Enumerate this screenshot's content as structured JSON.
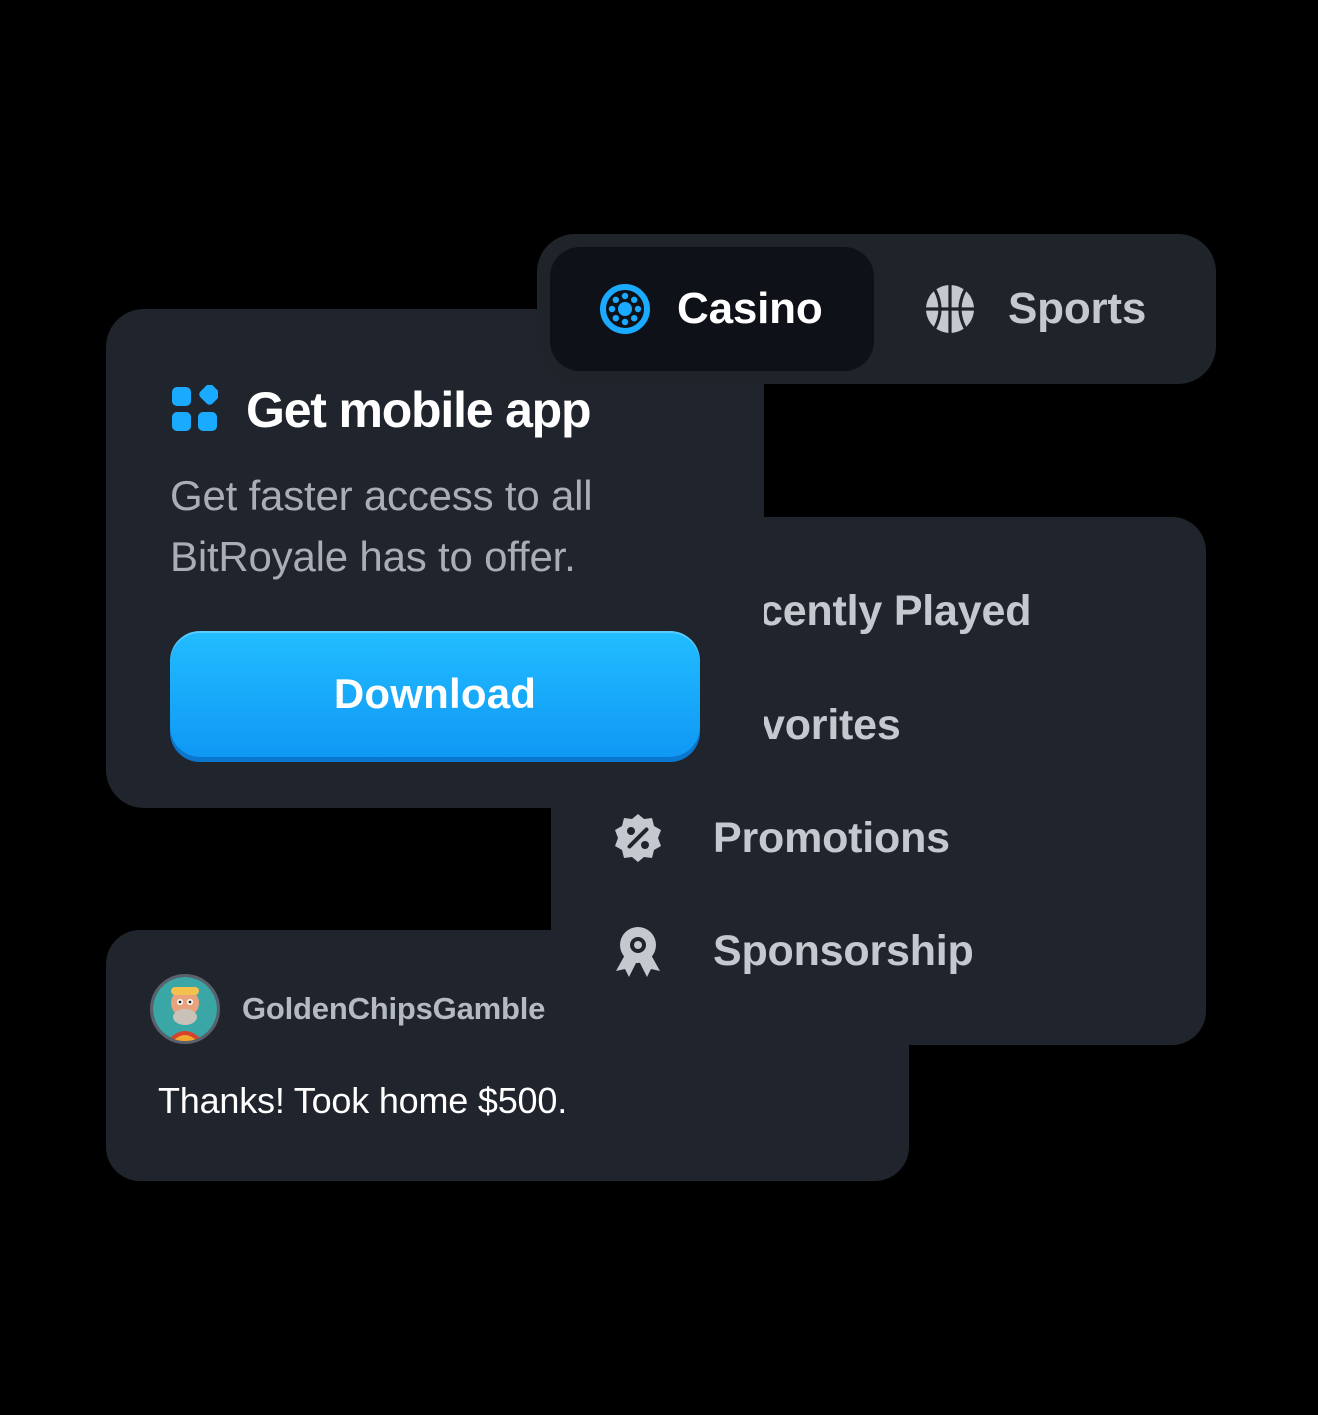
{
  "tabs": [
    {
      "label": "Casino",
      "icon": "roulette-icon",
      "active": true
    },
    {
      "label": "Sports",
      "icon": "basketball-icon",
      "active": false
    }
  ],
  "app_card": {
    "icon": "apps-grid-icon",
    "title": "Get mobile app",
    "description": "Get faster access to all BitRoyale has to offer.",
    "button_label": "Download"
  },
  "menu": {
    "items": [
      {
        "label": "cently Played",
        "icon": ""
      },
      {
        "label": "vorites",
        "icon": ""
      },
      {
        "label": "Promotions",
        "icon": "discount-badge-icon"
      },
      {
        "label": "Sponsorship",
        "icon": "award-ribbon-icon"
      }
    ]
  },
  "review": {
    "username": "GoldenChipsGamble",
    "message": "Thanks! Took home $500."
  },
  "colors": {
    "background": "#000000",
    "card": "#20242c",
    "accent": "#1aaaff",
    "active_tab": "#0e1117"
  }
}
